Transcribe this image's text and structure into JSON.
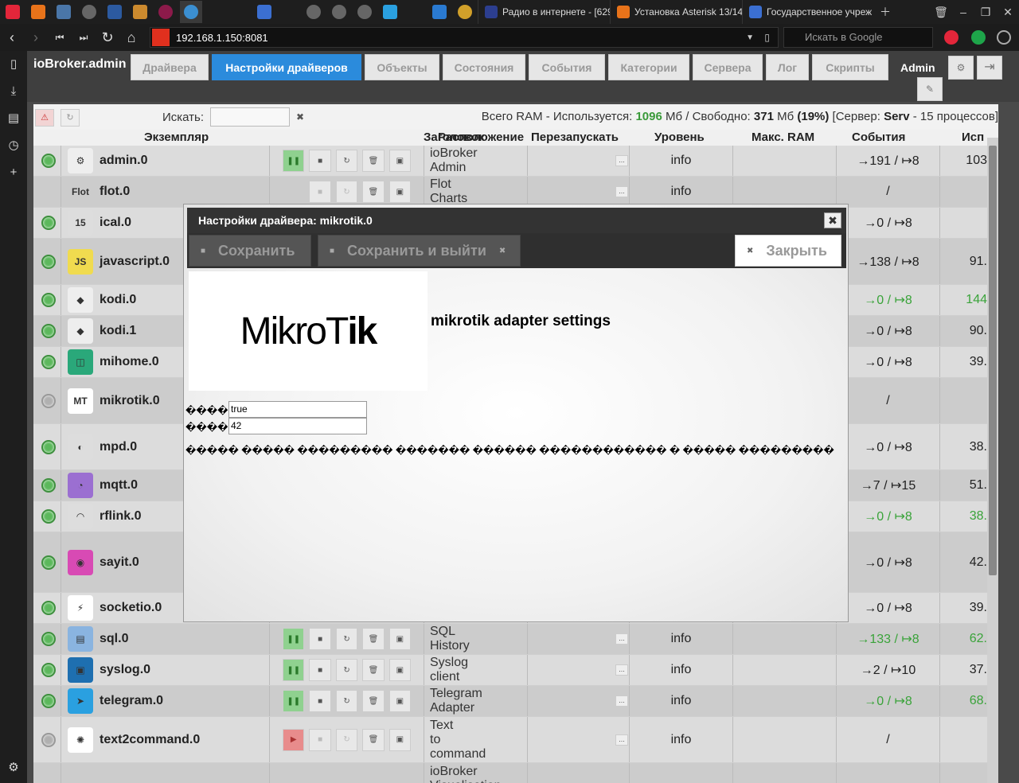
{
  "browser": {
    "tabs": [
      {
        "label": "Радио в интернете - [629",
        "color": "#2c3e8f"
      },
      {
        "label": "Установка Asterisk 13/14",
        "color": "#e8731a"
      },
      {
        "label": "Государственное учреж",
        "color": "#3b6fd1"
      }
    ],
    "url": "192.168.1.150:8081",
    "search_placeholder": "Искать в Google"
  },
  "app": {
    "title": "ioBroker.admin",
    "tabs": [
      "Драйвера",
      "Настройки драйверов",
      "Объекты",
      "Состояния",
      "События",
      "Категории",
      "Сервера",
      "Лог",
      "Скрипты"
    ],
    "active_tab": "Настройки драйверов",
    "user": "Admin"
  },
  "toolbar": {
    "search_label": "Искать:",
    "ram_prefix": "Всего RAM - Используется:",
    "ram_used": "1096",
    "ram_unit1": "Мб / Свободно:",
    "ram_free": "371",
    "ram_unit2": "Мб",
    "ram_pct": "(19%)",
    "server_prefix": "[Сервер:",
    "server_name": "Serv",
    "server_suffix": "- 15 процессов]"
  },
  "table": {
    "headers": {
      "instance": "Экземпляр",
      "title": "Заголовок",
      "location": "Расположение",
      "restart": "Перезапускать",
      "level": "Уровень",
      "max_ram": "Макс. RAM",
      "events": "События",
      "used": "Исп"
    },
    "rows": [
      {
        "name": "admin.0",
        "title": [
          "ioBroker",
          "Admin"
        ],
        "level": "info",
        "events": "→191 / ↦8",
        "used": "103",
        "running": true,
        "green": false,
        "icon": "gear-icon"
      },
      {
        "name": "flot.0",
        "title": [
          "Flot",
          "Charts"
        ],
        "level": "info",
        "events": "/",
        "used": "",
        "running": null,
        "green": false,
        "icon": "flot-icon"
      },
      {
        "name": "ical.0",
        "title": [],
        "level": "",
        "events": "→0 / ↦8",
        "used": "",
        "running": true,
        "green": false,
        "icon": "calendar-icon"
      },
      {
        "name": "javascript.0",
        "title": [],
        "level": "",
        "events": "→138 / ↦8",
        "used": "91.",
        "running": true,
        "green": false,
        "icon": "js-icon"
      },
      {
        "name": "kodi.0",
        "title": [],
        "level": "",
        "events": "→0 / ↦8",
        "used": "144",
        "running": true,
        "green": true,
        "icon": "kodi-icon"
      },
      {
        "name": "kodi.1",
        "title": [],
        "level": "",
        "events": "→0 / ↦8",
        "used": "90.",
        "running": true,
        "green": false,
        "icon": "kodi-icon"
      },
      {
        "name": "mihome.0",
        "title": [],
        "level": "",
        "events": "→0 / ↦8",
        "used": "39.",
        "running": true,
        "green": false,
        "icon": "mihome-icon"
      },
      {
        "name": "mikrotik.0",
        "title": [],
        "level": "",
        "events": "/",
        "used": "",
        "running": false,
        "green": false,
        "icon": "mikrotik-icon"
      },
      {
        "name": "mpd.0",
        "title": [],
        "level": "",
        "events": "→0 / ↦8",
        "used": "38.",
        "running": true,
        "green": false,
        "icon": "speaker-icon"
      },
      {
        "name": "mqtt.0",
        "title": [],
        "level": "",
        "events": "→7 / ↦15",
        "used": "51.",
        "running": true,
        "green": false,
        "icon": "mqtt-icon"
      },
      {
        "name": "rflink.0",
        "title": [],
        "level": "",
        "events": "→0 / ↦8",
        "used": "38.",
        "running": true,
        "green": true,
        "icon": "headphones-icon"
      },
      {
        "name": "sayit.0",
        "title": [],
        "level": "",
        "events": "→0 / ↦8",
        "used": "42.",
        "running": true,
        "green": false,
        "icon": "sayit-icon"
      },
      {
        "name": "socketio.0",
        "title": [],
        "level": "",
        "events": "→0 / ↦8",
        "used": "39.",
        "running": true,
        "green": false,
        "icon": "socketio-icon"
      },
      {
        "name": "sql.0",
        "title": [
          "SQL",
          "History"
        ],
        "level": "info",
        "events": "→133 / ↦8",
        "used": "62.",
        "running": true,
        "green": true,
        "icon": "database-icon"
      },
      {
        "name": "syslog.0",
        "title": [
          "Syslog",
          "client"
        ],
        "level": "info",
        "events": "→2 / ↦10",
        "used": "37.",
        "running": true,
        "green": false,
        "icon": "syslog-icon"
      },
      {
        "name": "telegram.0",
        "title": [
          "Telegram",
          "Adapter"
        ],
        "level": "info",
        "events": "→0 / ↦8",
        "used": "68.",
        "running": true,
        "green": true,
        "icon": "telegram-icon"
      },
      {
        "name": "text2command.0",
        "title": [
          "Text",
          "to",
          "command"
        ],
        "level": "info",
        "events": "/",
        "used": "",
        "running": false,
        "green": false,
        "icon": "brain-icon"
      },
      {
        "name": "",
        "title": [
          "ioBroker",
          "Visualisation"
        ],
        "level": "",
        "events": "",
        "used": "",
        "running": null,
        "green": false,
        "icon": ""
      }
    ]
  },
  "modal": {
    "title": "Настройки драйвера: mikrotik.0",
    "save_label": "Сохранить",
    "save_exit_label": "Сохранить и выйти",
    "close_label": "Закрыть",
    "logo_thin": "MikroT",
    "logo_bold": "ik",
    "heading": "mikrotik adapter settings",
    "field1_label": "���� 1",
    "field1_value": "true",
    "field2_label": "���� 2",
    "field2_value": "42",
    "note": "����� ����� ��������� ������� ������ ������������ � ����� ���������"
  }
}
